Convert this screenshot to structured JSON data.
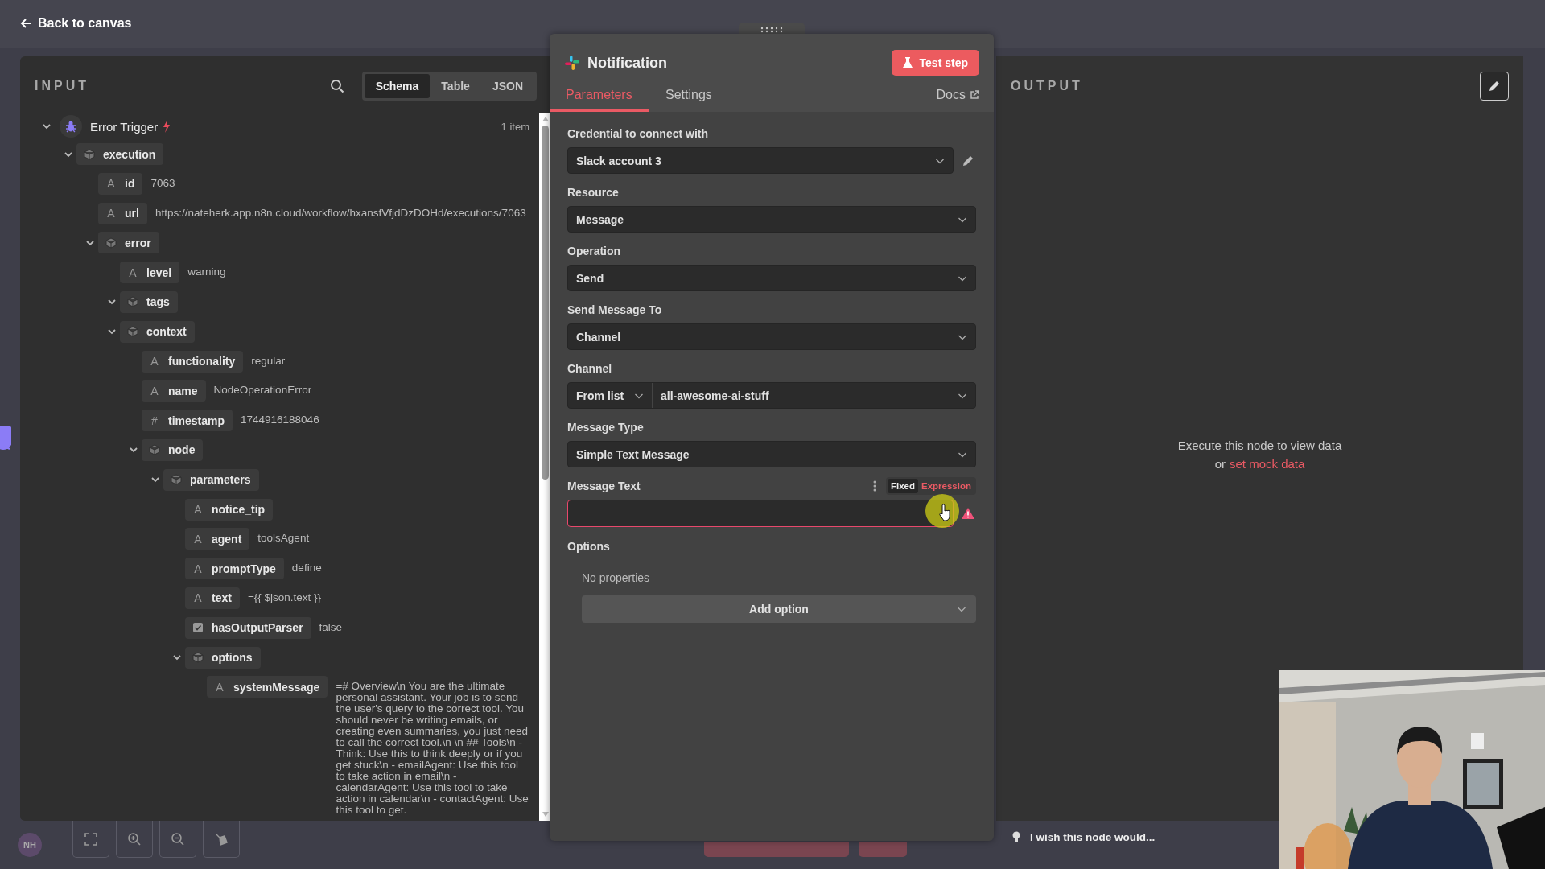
{
  "top_bar": {
    "back_link": "Back to canvas"
  },
  "input_panel": {
    "title": "INPUT",
    "view_tabs": [
      {
        "label": "Schema",
        "selected": true
      },
      {
        "label": "Table",
        "selected": false
      },
      {
        "label": "JSON",
        "selected": false
      }
    ],
    "root": {
      "label": "Error Trigger",
      "item_count": "1 item",
      "expanded": true,
      "children": [
        {
          "kind": "object",
          "key": "execution",
          "expanded": true,
          "children": [
            {
              "kind": "string",
              "glyph": "A",
              "key": "id",
              "value": "7063"
            },
            {
              "kind": "string",
              "glyph": "A",
              "key": "url",
              "value": "https://nateherk.app.n8n.cloud/workflow/hxansfVfjdDzDOHd/executions/7063"
            },
            {
              "kind": "object",
              "key": "error",
              "expanded": true,
              "children": [
                {
                  "kind": "string",
                  "glyph": "A",
                  "key": "level",
                  "value": "warning"
                },
                {
                  "kind": "object",
                  "key": "tags",
                  "expanded": true
                },
                {
                  "kind": "object",
                  "key": "context",
                  "expanded": true,
                  "children": [
                    {
                      "kind": "string",
                      "glyph": "A",
                      "key": "functionality",
                      "value": "regular"
                    },
                    {
                      "kind": "string",
                      "glyph": "A",
                      "key": "name",
                      "value": "NodeOperationError"
                    },
                    {
                      "kind": "number",
                      "glyph": "#",
                      "key": "timestamp",
                      "value": "1744916188046"
                    },
                    {
                      "kind": "object",
                      "key": "node",
                      "expanded": true,
                      "children": [
                        {
                          "kind": "object",
                          "key": "parameters",
                          "expanded": true,
                          "children": [
                            {
                              "kind": "string",
                              "glyph": "A",
                              "key": "notice_tip"
                            },
                            {
                              "kind": "string",
                              "glyph": "A",
                              "key": "agent",
                              "value": "toolsAgent"
                            },
                            {
                              "kind": "string",
                              "glyph": "A",
                              "key": "promptType",
                              "value": "define"
                            },
                            {
                              "kind": "string",
                              "glyph": "A",
                              "key": "text",
                              "value": "={{ $json.text }}"
                            },
                            {
                              "kind": "boolean",
                              "key": "hasOutputParser",
                              "value": "false"
                            },
                            {
                              "kind": "object",
                              "key": "options",
                              "expanded": true,
                              "children": [
                                {
                                  "kind": "string",
                                  "glyph": "A",
                                  "key": "systemMessage",
                                  "value": "=# Overview\\n You are the ultimate personal assistant. Your job is to send the user's query to the correct tool. You should never be writing emails, or creating even summaries, you just need to call the correct tool.\\n \\n ## Tools\\n - Think: Use this to think deeply or if you get stuck\\n - emailAgent: Use this tool to take action in email\\n - calendarAgent: Use this tool to take action in calendar\\n - contactAgent: Use this tool to get."
                                }
                              ]
                            }
                          ]
                        }
                      ]
                    }
                  ]
                }
              ]
            }
          ]
        }
      ]
    }
  },
  "node_panel": {
    "title": "Notification",
    "test_button": "Test step",
    "tabs": [
      {
        "label": "Parameters",
        "selected": true
      },
      {
        "label": "Settings",
        "selected": false
      }
    ],
    "docs_link": "Docs",
    "fields": [
      {
        "kind": "credential",
        "label": "Credential to connect with",
        "value": "Slack account 3"
      },
      {
        "kind": "select",
        "label": "Resource",
        "value": "Message"
      },
      {
        "kind": "select",
        "label": "Operation",
        "value": "Send"
      },
      {
        "kind": "select",
        "label": "Send Message To",
        "value": "Channel"
      },
      {
        "kind": "channel",
        "label": "Channel",
        "mode": "From list",
        "value": "all-awesome-ai-stuff"
      },
      {
        "kind": "select",
        "label": "Message Type",
        "value": "Simple Text Message"
      },
      {
        "kind": "text",
        "label": "Message Text",
        "error": true,
        "modes": [
          {
            "label": "Fixed",
            "selected": true
          },
          {
            "label": "Expression",
            "selected": false
          }
        ]
      }
    ],
    "options": {
      "label": "Options",
      "empty_text": "No properties",
      "add_button": "Add option"
    }
  },
  "output_panel": {
    "title": "OUTPUT",
    "empty_text": "Execute this node to view data",
    "empty_prefix": "or",
    "mock_link": "set mock data"
  },
  "feedback": "I wish this node would...",
  "user_avatar": "NH"
}
